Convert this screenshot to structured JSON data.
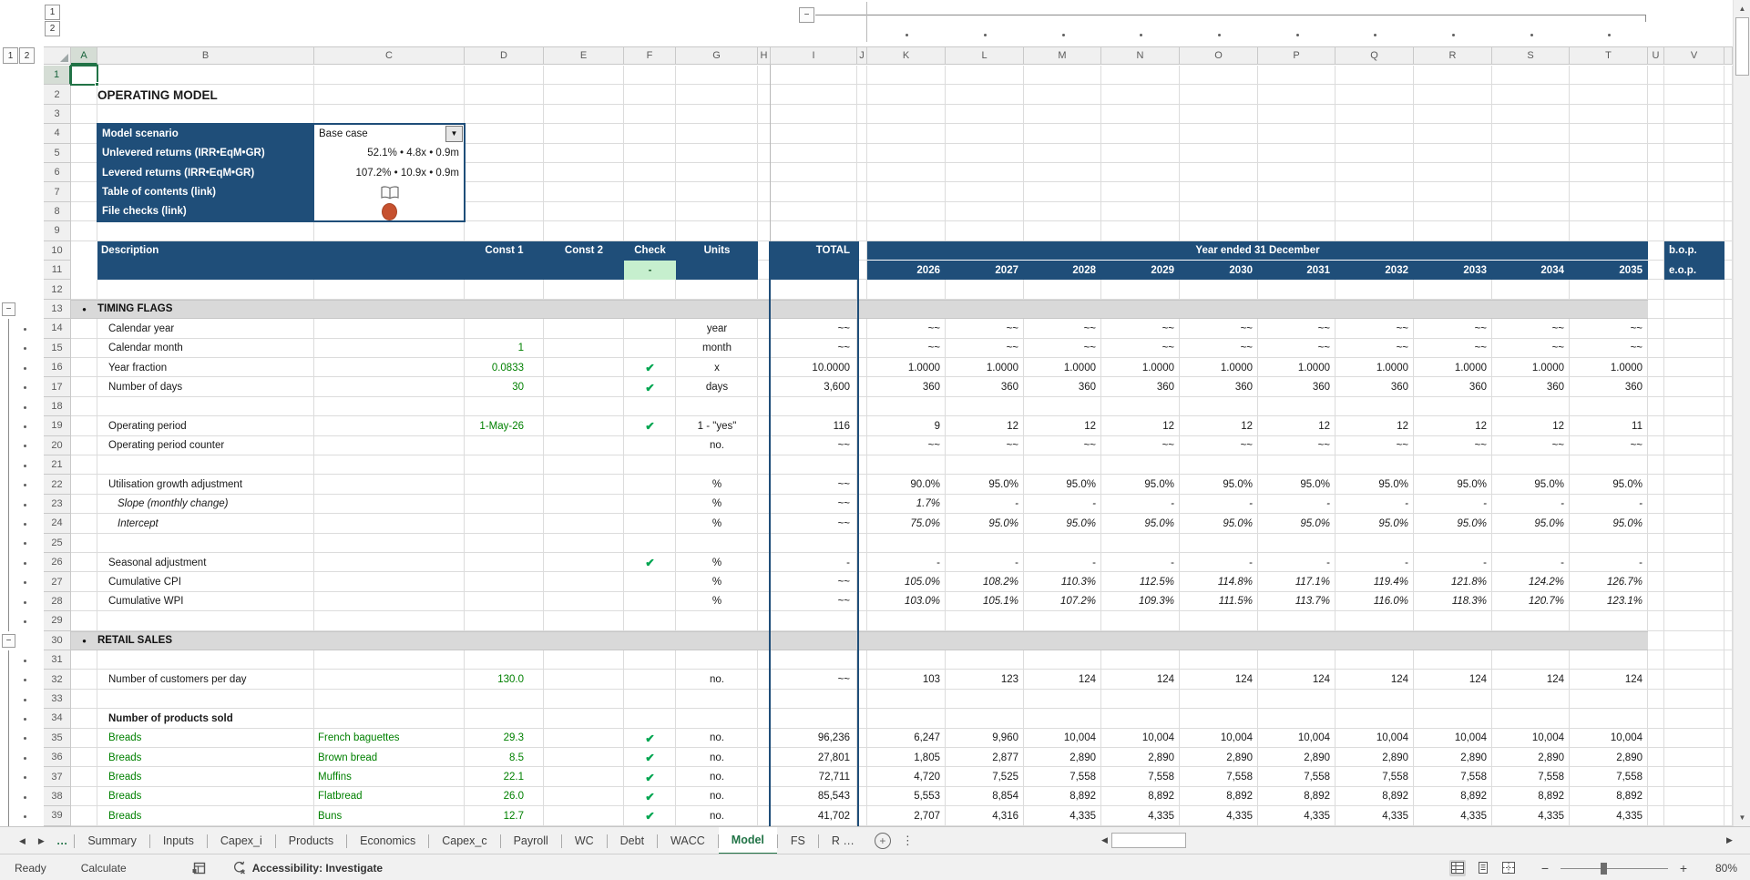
{
  "title_cell": "OPERATING MODEL",
  "scenario_panel": {
    "rows": [
      {
        "label": "Model scenario",
        "value": "Base case",
        "kind": "dropdown"
      },
      {
        "label": "Unlevered returns (IRR•EqM•GR)",
        "value": "52.1% • 4.8x • 0.9m",
        "kind": "text"
      },
      {
        "label": "Levered returns (IRR•EqM•GR)",
        "value": "107.2% • 10.9x • 0.9m",
        "kind": "text"
      },
      {
        "label": "Table of contents (link)",
        "value": "book-icon",
        "kind": "book"
      },
      {
        "label": "File checks (link)",
        "value": "red-status-circle",
        "kind": "circle"
      }
    ]
  },
  "table_header": {
    "description": "Description",
    "const1": "Const 1",
    "const2": "Const 2",
    "check": "Check",
    "units": "Units",
    "total": "TOTAL",
    "year_band": "Year ended 31 December",
    "years": [
      "2026",
      "2027",
      "2028",
      "2029",
      "2030",
      "2031",
      "2032",
      "2033",
      "2034",
      "2035"
    ],
    "bop": "b.o.p.",
    "eop": "e.o.p.",
    "check_flag": "-"
  },
  "grid": {
    "column_letters": [
      "A",
      "B",
      "C",
      "D",
      "E",
      "F",
      "G",
      "H",
      "I",
      "J",
      "K",
      "L",
      "M",
      "N",
      "O",
      "P",
      "Q",
      "R",
      "S",
      "T",
      "U",
      "V"
    ],
    "outline_levels_rows": [
      "1",
      "2"
    ],
    "outline_levels_cols": [
      "1",
      "2"
    ],
    "collapse_glyph": "−"
  },
  "rows": [
    {
      "n": 1
    },
    {
      "n": 2,
      "kind": "title",
      "label": "OPERATING MODEL"
    },
    {
      "n": 3
    },
    {
      "n": 4,
      "kind": "scen",
      "i": 0
    },
    {
      "n": 5,
      "kind": "scen",
      "i": 1
    },
    {
      "n": 6,
      "kind": "scen",
      "i": 2
    },
    {
      "n": 7,
      "kind": "scen",
      "i": 3
    },
    {
      "n": 8,
      "kind": "scen",
      "i": 4
    },
    {
      "n": 9
    },
    {
      "n": 10,
      "kind": "h1"
    },
    {
      "n": 11,
      "kind": "h2"
    },
    {
      "n": 12
    },
    {
      "n": 13,
      "kind": "section",
      "label": "TIMING FLAGS",
      "minus": true
    },
    {
      "n": 14,
      "dot": true,
      "label": "Calendar year",
      "u": "year",
      "tot": "~~",
      "yr": [
        "~~",
        "~~",
        "~~",
        "~~",
        "~~",
        "~~",
        "~~",
        "~~",
        "~~",
        "~~"
      ]
    },
    {
      "n": 15,
      "dot": true,
      "label": "Calendar month",
      "d": "1",
      "u": "month",
      "tot": "~~",
      "yr": [
        "~~",
        "~~",
        "~~",
        "~~",
        "~~",
        "~~",
        "~~",
        "~~",
        "~~",
        "~~"
      ]
    },
    {
      "n": 16,
      "dot": true,
      "label": "Year fraction",
      "d": "0.0833",
      "chk": true,
      "u": "x",
      "tot": "10.0000",
      "yr": [
        "1.0000",
        "1.0000",
        "1.0000",
        "1.0000",
        "1.0000",
        "1.0000",
        "1.0000",
        "1.0000",
        "1.0000",
        "1.0000"
      ]
    },
    {
      "n": 17,
      "dot": true,
      "label": "Number of days",
      "d": "30",
      "chk": true,
      "u": "days",
      "tot": "3,600",
      "yr": [
        "360",
        "360",
        "360",
        "360",
        "360",
        "360",
        "360",
        "360",
        "360",
        "360"
      ]
    },
    {
      "n": 18,
      "dot": true
    },
    {
      "n": 19,
      "dot": true,
      "label": "Operating period",
      "d": "1-May-26",
      "chk": true,
      "u": "1 - \"yes\"",
      "tot": "116",
      "yr": [
        "9",
        "12",
        "12",
        "12",
        "12",
        "12",
        "12",
        "12",
        "12",
        "11"
      ]
    },
    {
      "n": 20,
      "dot": true,
      "label": "Operating period counter",
      "u": "no.",
      "tot": "~~",
      "yr": [
        "~~",
        "~~",
        "~~",
        "~~",
        "~~",
        "~~",
        "~~",
        "~~",
        "~~",
        "~~"
      ]
    },
    {
      "n": 21,
      "dot": true
    },
    {
      "n": 22,
      "dot": true,
      "label": "Utilisation growth adjustment",
      "u": "%",
      "tot": "~~",
      "yr": [
        "90.0%",
        "95.0%",
        "95.0%",
        "95.0%",
        "95.0%",
        "95.0%",
        "95.0%",
        "95.0%",
        "95.0%",
        "95.0%"
      ]
    },
    {
      "n": 23,
      "dot": true,
      "label": "Slope (monthly change)",
      "ind": 1,
      "lab_ital": true,
      "val_ital": true,
      "u": "%",
      "tot": "~~",
      "yr": [
        "1.7%",
        "-",
        "-",
        "-",
        "-",
        "-",
        "-",
        "-",
        "-",
        "-"
      ]
    },
    {
      "n": 24,
      "dot": true,
      "label": "Intercept",
      "ind": 1,
      "lab_ital": true,
      "val_ital": true,
      "u": "%",
      "tot": "~~",
      "yr": [
        "75.0%",
        "95.0%",
        "95.0%",
        "95.0%",
        "95.0%",
        "95.0%",
        "95.0%",
        "95.0%",
        "95.0%",
        "95.0%"
      ]
    },
    {
      "n": 25,
      "dot": true
    },
    {
      "n": 26,
      "dot": true,
      "label": "Seasonal adjustment",
      "chk": true,
      "u": "%",
      "tot": "-",
      "yr": [
        "-",
        "-",
        "-",
        "-",
        "-",
        "-",
        "-",
        "-",
        "-",
        "-"
      ]
    },
    {
      "n": 27,
      "dot": true,
      "label": "Cumulative CPI",
      "val_ital": true,
      "u": "%",
      "tot": "~~",
      "yr": [
        "105.0%",
        "108.2%",
        "110.3%",
        "112.5%",
        "114.8%",
        "117.1%",
        "119.4%",
        "121.8%",
        "124.2%",
        "126.7%"
      ]
    },
    {
      "n": 28,
      "dot": true,
      "label": "Cumulative WPI",
      "val_ital": true,
      "u": "%",
      "tot": "~~",
      "yr": [
        "103.0%",
        "105.1%",
        "107.2%",
        "109.3%",
        "111.5%",
        "113.7%",
        "116.0%",
        "118.3%",
        "120.7%",
        "123.1%"
      ]
    },
    {
      "n": 29,
      "dot": true
    },
    {
      "n": 30,
      "kind": "section",
      "label": "RETAIL SALES",
      "minus": true
    },
    {
      "n": 31,
      "dot": true
    },
    {
      "n": 32,
      "dot": true,
      "label": "Number of customers per day",
      "d": "130.0",
      "u": "no.",
      "tot": "~~",
      "yr": [
        "103",
        "123",
        "124",
        "124",
        "124",
        "124",
        "124",
        "124",
        "124",
        "124"
      ]
    },
    {
      "n": 33,
      "dot": true
    },
    {
      "n": 34,
      "dot": true,
      "label": "Number of products sold",
      "bold": true
    },
    {
      "n": 35,
      "dot": true,
      "label": "Breads",
      "green": true,
      "c": "French baguettes",
      "d": "29.3",
      "chk": true,
      "u": "no.",
      "tot": "96,236",
      "yr": [
        "6,247",
        "9,960",
        "10,004",
        "10,004",
        "10,004",
        "10,004",
        "10,004",
        "10,004",
        "10,004",
        "10,004"
      ]
    },
    {
      "n": 36,
      "dot": true,
      "label": "Breads",
      "green": true,
      "c": "Brown bread",
      "d": "8.5",
      "chk": true,
      "u": "no.",
      "tot": "27,801",
      "yr": [
        "1,805",
        "2,877",
        "2,890",
        "2,890",
        "2,890",
        "2,890",
        "2,890",
        "2,890",
        "2,890",
        "2,890"
      ]
    },
    {
      "n": 37,
      "dot": true,
      "label": "Breads",
      "green": true,
      "c": "Muffins",
      "d": "22.1",
      "chk": true,
      "u": "no.",
      "tot": "72,711",
      "yr": [
        "4,720",
        "7,525",
        "7,558",
        "7,558",
        "7,558",
        "7,558",
        "7,558",
        "7,558",
        "7,558",
        "7,558"
      ]
    },
    {
      "n": 38,
      "dot": true,
      "label": "Breads",
      "green": true,
      "c": "Flatbread",
      "d": "26.0",
      "chk": true,
      "u": "no.",
      "tot": "85,543",
      "yr": [
        "5,553",
        "8,854",
        "8,892",
        "8,892",
        "8,892",
        "8,892",
        "8,892",
        "8,892",
        "8,892",
        "8,892"
      ]
    },
    {
      "n": 39,
      "dot": true,
      "label": "Breads",
      "green": true,
      "c": "Buns",
      "d": "12.7",
      "chk": true,
      "u": "no.",
      "tot": "41,702",
      "yr": [
        "2,707",
        "4,316",
        "4,335",
        "4,335",
        "4,335",
        "4,335",
        "4,335",
        "4,335",
        "4,335",
        "4,335"
      ]
    }
  ],
  "sheet_tabs": {
    "overflow": "…",
    "tabs": [
      "Summary",
      "Inputs",
      "Capex_i",
      "Products",
      "Economics",
      "Capex_c",
      "Payroll",
      "WC",
      "Debt",
      "WACC",
      "Model",
      "FS",
      "R …"
    ],
    "active": "Model"
  },
  "status_bar": {
    "ready": "Ready",
    "calculate": "Calculate",
    "accessibility": "Accessibility: Investigate",
    "zoom": "80%"
  },
  "colors": {
    "navy": "#1F4E79",
    "input_green": "#008000",
    "check_green": "#00A550",
    "good_cell_bg": "#C6EFCE",
    "section_gray": "#D9D9D9",
    "excel_green": "#217346",
    "alert_red": "#C6512F"
  }
}
